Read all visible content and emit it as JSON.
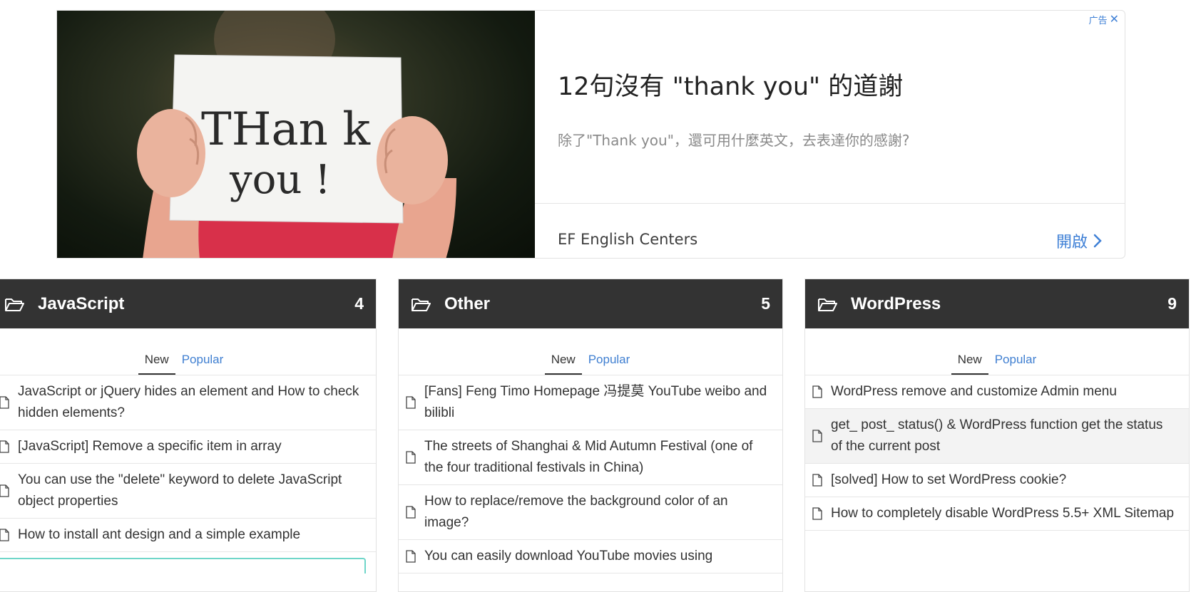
{
  "ad": {
    "badge": "广告",
    "close_glyph": "✕",
    "headline": "12句沒有 \"thank you\" 的道謝",
    "description": "除了\"Thank you\"，還可用什麼英文，去表達你的感謝?",
    "advertiser": "EF English Centers",
    "cta": "開啟",
    "image_text_line1": "THan k",
    "image_text_line2": "you !"
  },
  "tabs": {
    "new": "New",
    "popular": "Popular"
  },
  "panels": [
    {
      "title": "JavaScript",
      "count": "4",
      "posts": [
        "JavaScript or jQuery hides an element and How to check hidden elements?",
        "[JavaScript] Remove a specific item in array",
        "You can use the \"delete\" keyword to delete JavaScript object properties",
        "How to install ant design and a simple example"
      ]
    },
    {
      "title": "Other",
      "count": "5",
      "posts": [
        "[Fans] Feng Timo Homepage 冯提莫 YouTube weibo and bilibli",
        "The streets of Shanghai & Mid Autumn Festival (one of the four traditional festivals in China)",
        "How to replace/remove the background color of an image?",
        "You can easily download YouTube movies using"
      ]
    },
    {
      "title": "WordPress",
      "count": "9",
      "posts": [
        "WordPress remove and customize Admin menu",
        "get_ post_ status() & WordPress function get the status of the current post",
        "[solved] How to set WordPress cookie?",
        "How to completely disable WordPress 5.5+ XML Sitemap"
      ]
    }
  ],
  "colors": {
    "header_bg": "#333333",
    "link_blue": "#3f7fd1",
    "ad_blue": "#3f80d6"
  }
}
